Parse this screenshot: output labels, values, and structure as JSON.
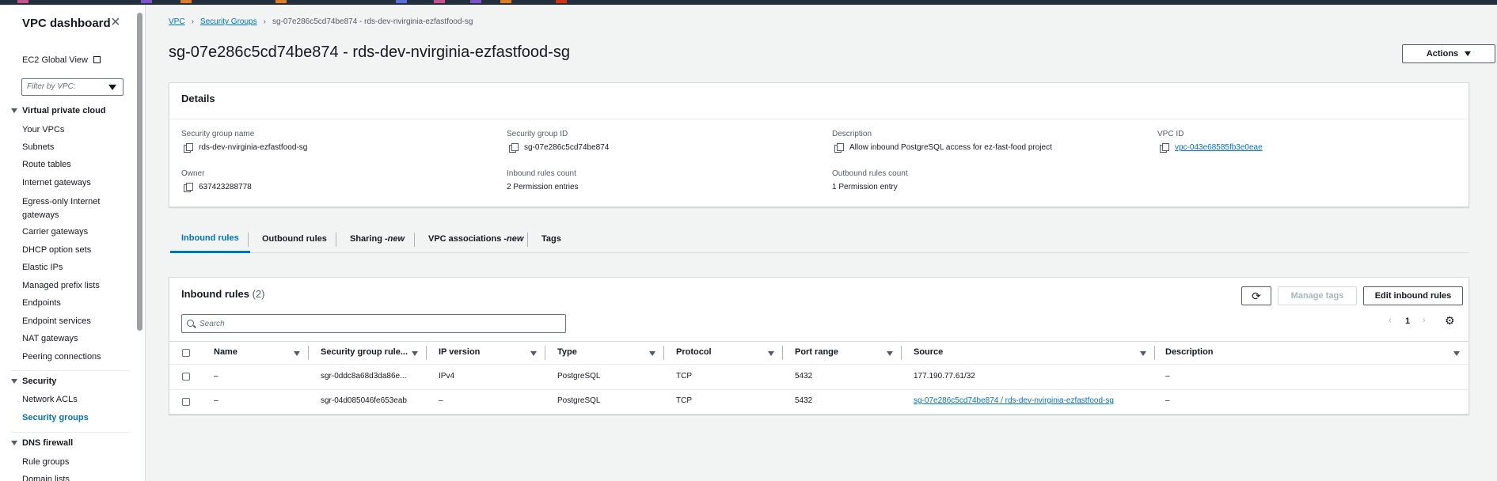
{
  "sidebar": {
    "title": "VPC dashboard",
    "global_view": "EC2 Global View",
    "filter_placeholder": "Filter by VPC:",
    "sections": [
      {
        "label": "Virtual private cloud",
        "items": [
          "Your VPCs",
          "Subnets",
          "Route tables",
          "Internet gateways",
          "Egress-only Internet gateways",
          "Carrier gateways",
          "DHCP option sets",
          "Elastic IPs",
          "Managed prefix lists",
          "Endpoints",
          "Endpoint services",
          "NAT gateways",
          "Peering connections"
        ]
      },
      {
        "label": "Security",
        "items": [
          "Network ACLs",
          "Security groups"
        ]
      },
      {
        "label": "DNS firewall",
        "items": [
          "Rule groups",
          "Domain lists"
        ]
      }
    ]
  },
  "breadcrumb": {
    "vpc": "VPC",
    "security_groups": "Security Groups",
    "current": "sg-07e286c5cd74be874 - rds-dev-nvirginia-ezfastfood-sg"
  },
  "page": {
    "title": "sg-07e286c5cd74be874 - rds-dev-nvirginia-ezfastfood-sg",
    "actions_label": "Actions"
  },
  "details": {
    "heading": "Details",
    "fields": {
      "sg_name_label": "Security group name",
      "sg_name": "rds-dev-nvirginia-ezfastfood-sg",
      "sg_id_label": "Security group ID",
      "sg_id": "sg-07e286c5cd74be874",
      "description_label": "Description",
      "description": "Allow inbound PostgreSQL access for ez-fast-food project",
      "vpc_id_label": "VPC ID",
      "vpc_id": "vpc-043e68585fb3e0eae",
      "owner_label": "Owner",
      "owner": "637423288778",
      "inbound_count_label": "Inbound rules count",
      "inbound_count": "2 Permission entries",
      "outbound_count_label": "Outbound rules count",
      "outbound_count": "1 Permission entry"
    }
  },
  "tabs": {
    "inbound": "Inbound rules",
    "outbound": "Outbound rules",
    "sharing": "Sharing - ",
    "sharing_new": "new",
    "vpc_assoc": "VPC associations - ",
    "vpc_assoc_new": "new",
    "tags": "Tags"
  },
  "inbound": {
    "heading": "Inbound rules",
    "count": "(2)",
    "manage_tags": "Manage tags",
    "edit": "Edit inbound rules",
    "search_placeholder": "Search",
    "page_number": "1",
    "columns": {
      "name": "Name",
      "rule_id": "Security group rule...",
      "ip_version": "IP version",
      "type": "Type",
      "protocol": "Protocol",
      "port_range": "Port range",
      "source": "Source",
      "description": "Description"
    },
    "rows": [
      {
        "name": "–",
        "rule_id": "sgr-0ddc8a68d3da86e...",
        "ip_version": "IPv4",
        "type": "PostgreSQL",
        "protocol": "TCP",
        "port_range": "5432",
        "source": "177.190.77.61/32",
        "description": "–"
      },
      {
        "name": "–",
        "rule_id": "sgr-04d085046fe653eab",
        "ip_version": "–",
        "type": "PostgreSQL",
        "protocol": "TCP",
        "port_range": "5432",
        "source": "sg-07e286c5cd74be874 / rds-dev-nvirginia-ezfastfood-sg",
        "description": "–"
      }
    ]
  }
}
